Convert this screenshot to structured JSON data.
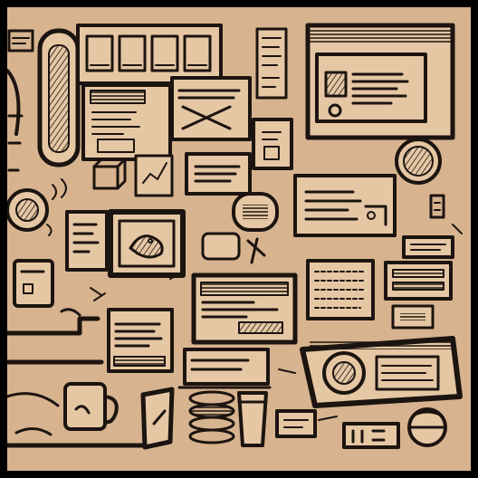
{
  "canvas": {
    "background": "#d7b48f",
    "frame": "#000000",
    "ink": "#1c1410",
    "paper": "#e6c7a4",
    "shade": "#b48c68"
  },
  "icons": {
    "hourglass_shape": "capsule-icon",
    "toolbar_panel": "toolbar-icon",
    "browser_window": "browser-window-icon",
    "fish_frame": "fish-icon",
    "mug": "coffee-mug-icon",
    "round_badge": "round-badge-icon",
    "scanner_machine": "scanner-icon"
  }
}
